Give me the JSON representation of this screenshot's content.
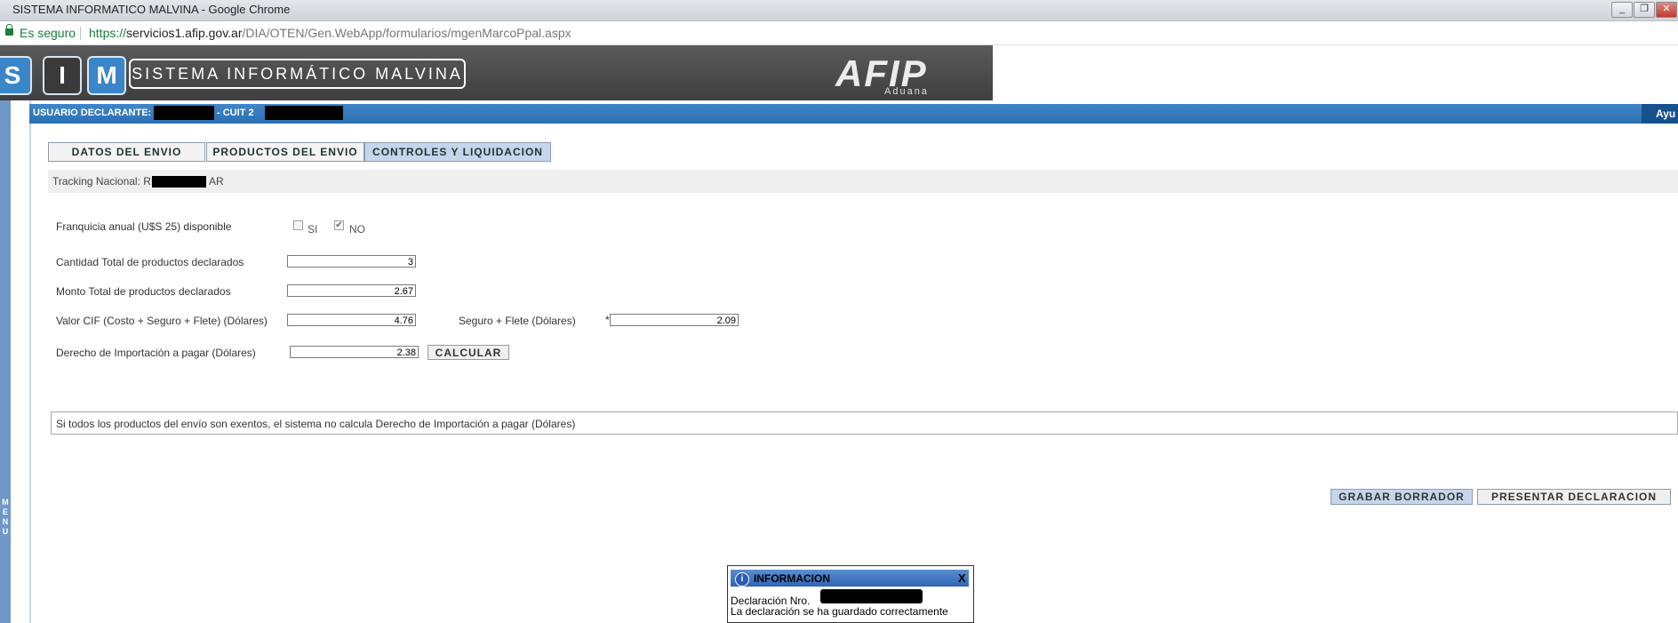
{
  "browser": {
    "window_title": "SISTEMA INFORMATICO MALVINA - Google Chrome",
    "secure_label": "Es seguro",
    "url_prefix": "https://",
    "url_host": "servicios1.afip.gov.ar",
    "url_path": "/DIA/OTEN/Gen.WebApp/formularios/mgenMarcoPpal.aspx",
    "minimize": "_",
    "restore": "❐",
    "close": "✕"
  },
  "header": {
    "sim_letters": [
      "S",
      "I",
      "M"
    ],
    "sim_title": "SISTEMA INFORMÁTICO MALVINA",
    "afip_logo": "AFIP",
    "afip_sub": "Aduana"
  },
  "userbar": {
    "label": "USUARIO DECLARANTE: 20",
    "cuit_label": "- CUIT 2",
    "help": "Ayu"
  },
  "menu_label": "M E N U",
  "tabs": [
    {
      "label": "DATOS DEL ENVIO"
    },
    {
      "label": "PRODUCTOS DEL ENVIO"
    },
    {
      "label": "CONTROLES Y LIQUIDACION"
    }
  ],
  "tracking": {
    "label_prefix": "Tracking Nacional: RD",
    "label_suffix": "AR"
  },
  "form": {
    "franquicia_label": "Franquicia anual (U$S 25) disponible",
    "si_label": "SI",
    "no_label": "NO",
    "si_checked": false,
    "no_checked": true,
    "cantidad_label": "Cantidad Total de productos declarados",
    "cantidad_value": "3",
    "monto_label": "Monto Total de productos declarados",
    "monto_value": "2.67",
    "cif_label": "Valor CIF (Costo + Seguro + Flete) (Dólares)",
    "cif_value": "4.76",
    "seguro_label": "Seguro + Flete (Dólares)",
    "seguro_required": "*",
    "seguro_value": "2.09",
    "derecho_label": "Derecho de Importación a pagar (Dólares)",
    "derecho_value": "2.38",
    "calcular": "CALCULAR"
  },
  "note": "Si todos los productos del envío son exentos, el sistema no calcula Derecho de Importación a pagar (Dólares)",
  "actions": {
    "grabar": "GRABAR BORRADOR",
    "presentar": "PRESENTAR DECLARACION"
  },
  "popup": {
    "title": "INFORMACION",
    "close": "X",
    "line1": "Declaración Nro.",
    "line2": "La declaración se ha guardado correctamente"
  }
}
